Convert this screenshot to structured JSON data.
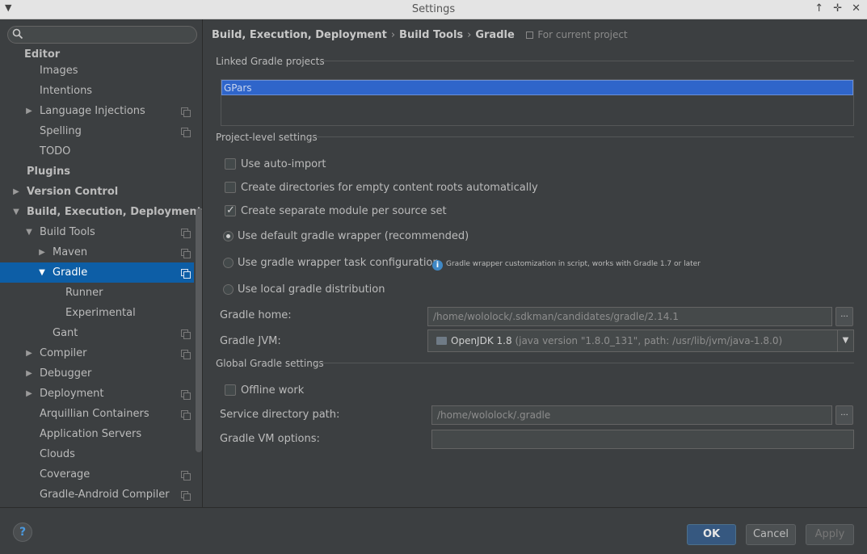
{
  "window": {
    "title": "Settings",
    "buttons": [
      "↑",
      "✛",
      "✕"
    ]
  },
  "search": {
    "placeholder": ""
  },
  "tree": [
    {
      "label": "Editor",
      "level": 0,
      "bold": true
    },
    {
      "label": "Images",
      "level": 2
    },
    {
      "label": "Intentions",
      "level": 2
    },
    {
      "label": "Language Injections",
      "level": 2,
      "arrow": "right",
      "copy": true
    },
    {
      "label": "Spelling",
      "level": 2,
      "copy": true
    },
    {
      "label": "TODO",
      "level": 2
    },
    {
      "label": "Plugins",
      "level": 1,
      "bold": true
    },
    {
      "label": "Version Control",
      "level": 1,
      "bold": true,
      "arrow": "right"
    },
    {
      "label": "Build, Execution, Deployment",
      "level": 1,
      "bold": true,
      "arrow": "down"
    },
    {
      "label": "Build Tools",
      "level": 2,
      "arrow": "down",
      "copy": true
    },
    {
      "label": "Maven",
      "level": 3,
      "arrow": "right",
      "copy": true
    },
    {
      "label": "Gradle",
      "level": 3,
      "arrow": "down",
      "copy": true,
      "selected": true
    },
    {
      "label": "Runner",
      "level": 4
    },
    {
      "label": "Experimental",
      "level": 4
    },
    {
      "label": "Gant",
      "level": 3,
      "copy": true
    },
    {
      "label": "Compiler",
      "level": 2,
      "arrow": "right",
      "copy": true
    },
    {
      "label": "Debugger",
      "level": 2,
      "arrow": "right"
    },
    {
      "label": "Deployment",
      "level": 2,
      "arrow": "right",
      "copy": true
    },
    {
      "label": "Arquillian Containers",
      "level": 2,
      "copy": true
    },
    {
      "label": "Application Servers",
      "level": 2
    },
    {
      "label": "Clouds",
      "level": 2
    },
    {
      "label": "Coverage",
      "level": 2,
      "copy": true
    },
    {
      "label": "Gradle-Android Compiler",
      "level": 2,
      "copy": true
    }
  ],
  "breadcrumb": {
    "items": [
      "Build, Execution, Deployment",
      "Build Tools",
      "Gradle"
    ],
    "separator": "›",
    "scope": "For current project"
  },
  "sections": {
    "linked": "Linked Gradle projects",
    "project_level": "Project-level settings",
    "global": "Global Gradle settings"
  },
  "linked_projects": [
    "GPars"
  ],
  "options": {
    "auto_import": {
      "label": "Use auto-import",
      "checked": false
    },
    "create_dirs": {
      "label": "Create directories for empty content roots automatically",
      "checked": false
    },
    "separate_module": {
      "label": "Create separate module per source set",
      "checked": true
    },
    "default_wrapper": {
      "label": "Use default gradle wrapper (recommended)",
      "selected": true
    },
    "wrapper_task": {
      "label": "Use gradle wrapper task configuration",
      "selected": false
    },
    "local_dist": {
      "label": "Use local gradle distribution",
      "selected": false
    },
    "wrapper_info": "Gradle wrapper customization in script, works with Gradle 1.7 or later",
    "offline": {
      "label": "Offline work",
      "checked": false
    }
  },
  "fields": {
    "gradle_home": {
      "label": "Gradle home:",
      "value": "/home/wololock/.sdkman/candidates/gradle/2.14.1"
    },
    "gradle_jvm": {
      "label": "Gradle JVM:",
      "name": "OpenJDK 1.8",
      "detail": "(java version \"1.8.0_131\", path: /usr/lib/jvm/java-1.8.0)"
    },
    "service_dir": {
      "label": "Service directory path:",
      "value": "/home/wololock/.gradle"
    },
    "vm_options": {
      "label": "Gradle VM options:",
      "value": ""
    },
    "browse": "..."
  },
  "footer": {
    "help": "?",
    "ok": "OK",
    "cancel": "Cancel",
    "apply": "Apply"
  },
  "colors": {
    "accent": "#0d5ea6",
    "ok_button": "#365880",
    "project_selection": "#2f65ca"
  }
}
